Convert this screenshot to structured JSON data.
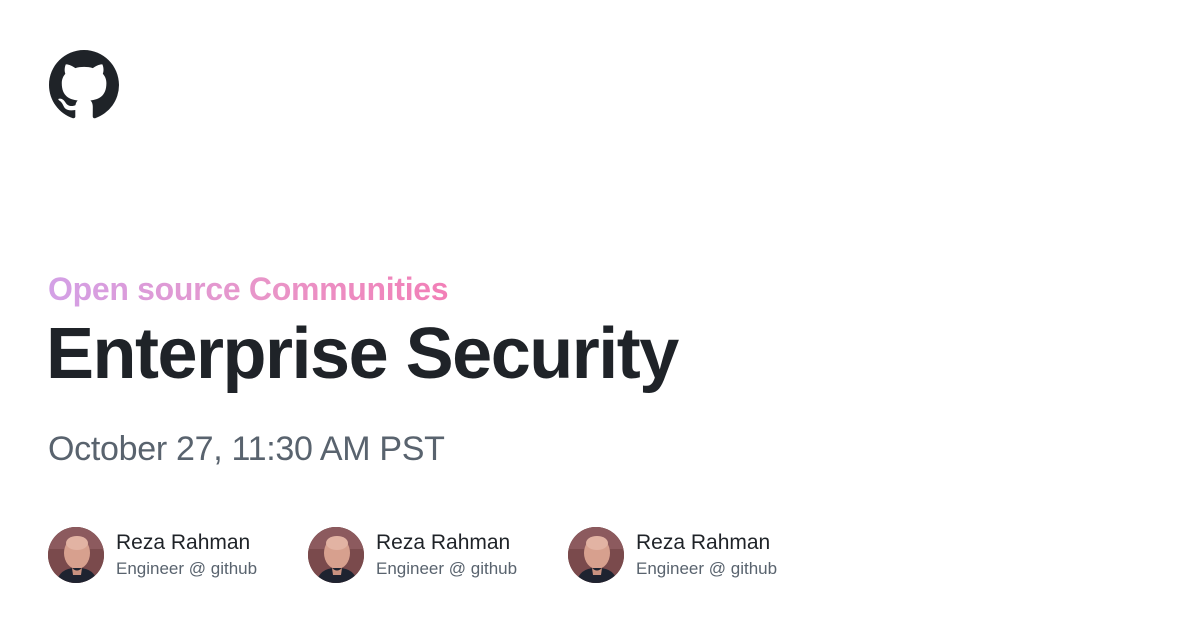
{
  "logo": {
    "icon": "github-octocat-icon",
    "color": "#1f2328"
  },
  "event": {
    "track": "Open source Communities",
    "title": "Enterprise Security",
    "datetime": "October 27, 11:30 AM PST"
  },
  "speakers": [
    {
      "name": "Reza Rahman",
      "role": "Engineer @ github"
    },
    {
      "name": "Reza Rahman",
      "role": "Engineer @ github"
    },
    {
      "name": "Reza Rahman",
      "role": "Engineer @ github"
    }
  ],
  "colors": {
    "title": "#1f2328",
    "muted": "#59636e",
    "track_gradient_start": "#d3a0e6",
    "track_gradient_end": "#f27fb7"
  }
}
